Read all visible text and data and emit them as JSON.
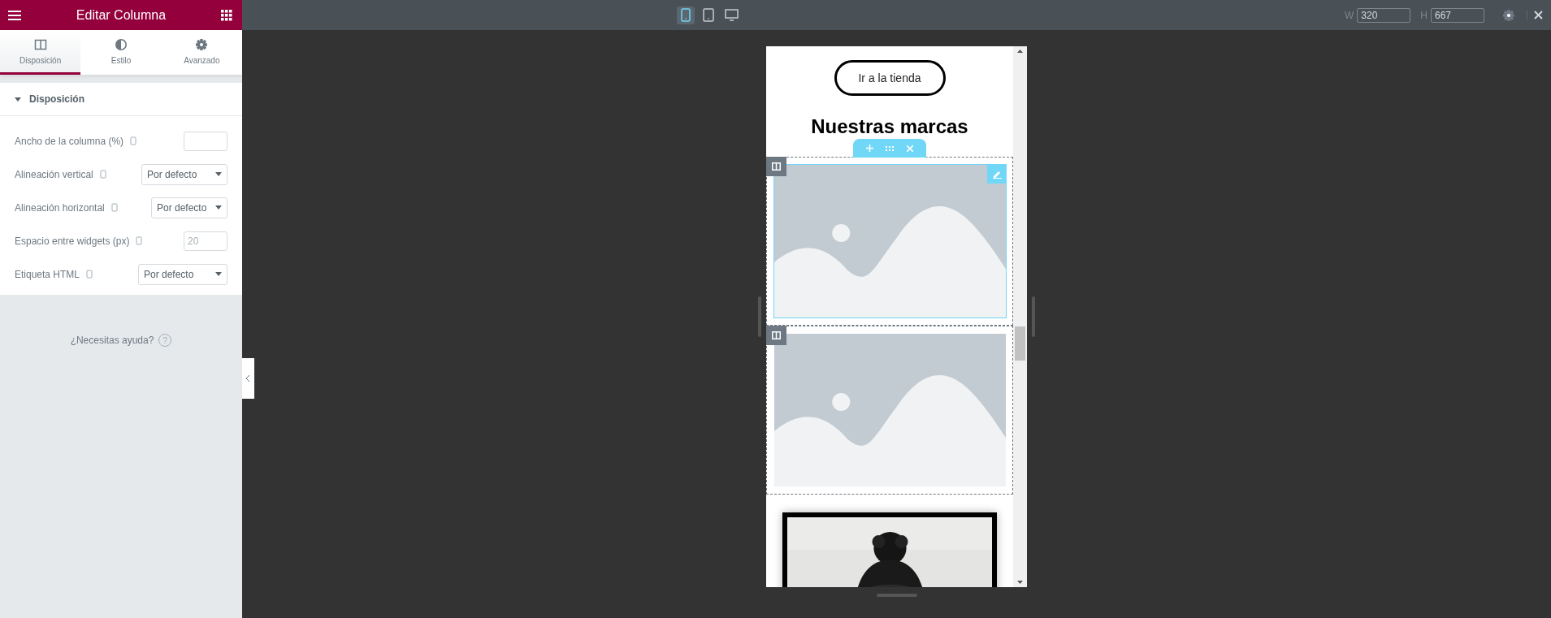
{
  "panel": {
    "title": "Editar Columna",
    "tabs": [
      {
        "label": "Disposición",
        "kind": "columns",
        "selected": true
      },
      {
        "label": "Estilo",
        "kind": "contrast",
        "selected": false
      },
      {
        "label": "Avanzado",
        "kind": "gear",
        "selected": false
      }
    ],
    "section": {
      "title": "Disposición",
      "expanded": true
    },
    "controls": [
      {
        "kind": "number",
        "label": "Ancho de la columna (%)"
      },
      {
        "kind": "select",
        "label": "Alineación vertical",
        "value": "Por defecto"
      },
      {
        "kind": "select",
        "label": "Alineación horizontal",
        "value": "Por defecto"
      },
      {
        "kind": "number",
        "label": "Espacio entre widgets (px)",
        "placeholder": "20"
      },
      {
        "kind": "select",
        "label": "Etiqueta HTML",
        "value": "Por defecto"
      }
    ],
    "help": "¿Necesitas ayuda?",
    "help_mark": "?"
  },
  "topbar": {
    "devices": [
      {
        "kind": "mobile",
        "selected": true
      },
      {
        "kind": "tablet",
        "selected": false
      },
      {
        "kind": "desktop",
        "selected": false
      }
    ],
    "width": {
      "label": "W",
      "value": "320"
    },
    "height": {
      "label": "H",
      "value": "667"
    }
  },
  "preview": {
    "button": "Ir a la tienda",
    "heading": "Nuestras marcas",
    "columns": [
      {
        "selected": true
      },
      {
        "selected": false
      }
    ]
  }
}
